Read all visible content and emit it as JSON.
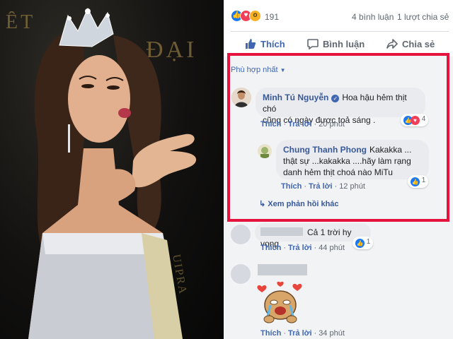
{
  "photo": {
    "bg_text_left": "ĐẠI",
    "bg_text_right": "ĐẠI",
    "bg_text_top": "ÊT",
    "sash_text": "UIPRA"
  },
  "post": {
    "reaction_count": "191",
    "comments_count": "4 bình luận",
    "shares_count": "1 lượt chia sẻ",
    "reaction_icons": [
      "like-icon",
      "love-icon",
      "wow-icon"
    ]
  },
  "actions": {
    "like": "Thích",
    "comment": "Bình luận",
    "share": "Chia sẻ"
  },
  "sort_label": "Phù hợp nhất",
  "comments": [
    {
      "author": "Minh Tú Nguyễn",
      "verified": true,
      "text_line1": "Hoa hậu hẻm thịt chó",
      "text_line2": "cũng có ngày được toả sáng .",
      "like_label": "Thích",
      "reply_label": "Trả lời",
      "time": "20 phút",
      "reaction_count": "4"
    },
    {
      "author": "Chung Thanh Phong",
      "text_line1": "Kakakka ...",
      "text_line2": "thật sự ...kakakka ....hãy làm rạng",
      "text_line3": "danh hẻm thịt choá nào MiTu",
      "like_label": "Thích",
      "reply_label": "Trả lời",
      "time": "12 phút",
      "reaction_count": "1"
    }
  ],
  "more_replies_label": "Xem phản hồi khác",
  "other_comments": [
    {
      "text": "Cả 1 trời hy vọng",
      "like_label": "Thích",
      "reply_label": "Trả lời",
      "time": "44 phút",
      "reaction_count": "1"
    },
    {
      "sticker": "crying-bear-hearts-sticker",
      "like_label": "Thích",
      "reply_label": "Trả lời",
      "time": "34 phút"
    }
  ],
  "colors": {
    "facebook_blue": "#4267b2",
    "highlight_red": "#e5123d",
    "comment_bubble": "#e9ebee"
  }
}
